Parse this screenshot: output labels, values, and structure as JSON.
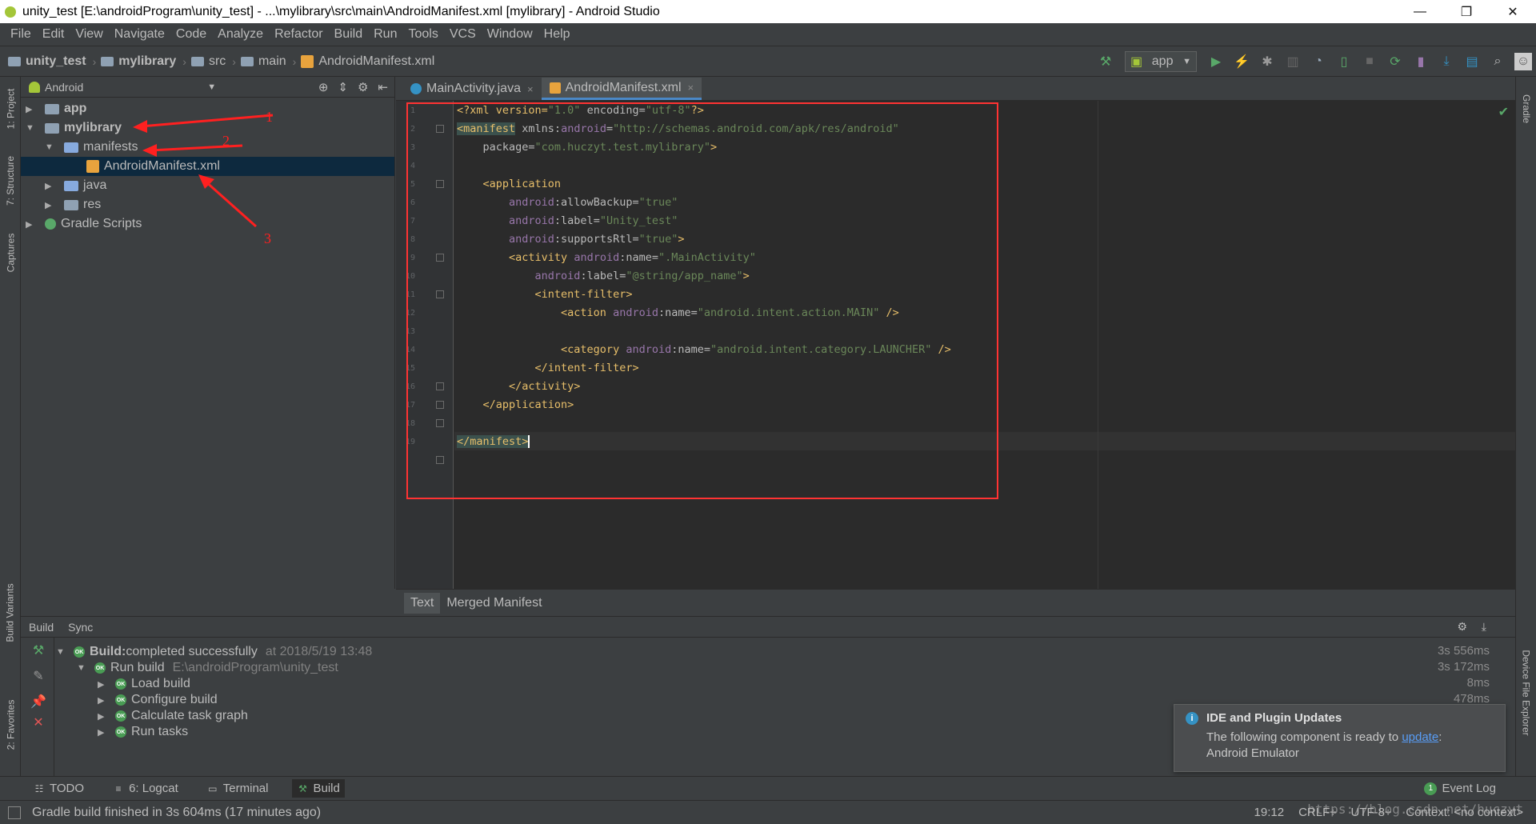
{
  "window": {
    "title": "unity_test [E:\\androidProgram\\unity_test] - ...\\mylibrary\\src\\main\\AndroidManifest.xml [mylibrary] - Android Studio",
    "minimize": "—",
    "restore": "❐",
    "close": "✕"
  },
  "menu": [
    "File",
    "Edit",
    "View",
    "Navigate",
    "Code",
    "Analyze",
    "Refactor",
    "Build",
    "Run",
    "Tools",
    "VCS",
    "Window",
    "Help"
  ],
  "breadcrumb": [
    "unity_test",
    "mylibrary",
    "src",
    "main",
    "AndroidManifest.xml"
  ],
  "run_config": "app",
  "left_tools": [
    "1: Project",
    "7: Structure",
    "Captures",
    "Build Variants",
    "2: Favorites"
  ],
  "right_tools": [
    "Gradle",
    "Device File Explorer"
  ],
  "project": {
    "view": "Android",
    "tree": [
      "app",
      "mylibrary",
      "manifests",
      "AndroidManifest.xml",
      "java",
      "res",
      "Gradle Scripts"
    ]
  },
  "annotations": [
    "1",
    "2",
    "3"
  ],
  "editor": {
    "tabs": [
      "MainActivity.java",
      "AndroidManifest.xml"
    ],
    "line_numbers": [
      "1",
      "2",
      "3",
      "4",
      "5",
      "6",
      "7",
      "8",
      "9",
      "10",
      "11",
      "12",
      "13",
      "14",
      "15",
      "16",
      "17",
      "18",
      "19"
    ],
    "code": {
      "l1a": "<?xml version=",
      "l1b": "\"1.0\"",
      "l1c": " encoding=",
      "l1d": "\"utf-8\"",
      "l1e": "?>",
      "l2a": "<manifest",
      "l2b": " xmlns:",
      "l2c": "android",
      "l2d": "=",
      "l2e": "\"http://schemas.android.com/apk/res/android\"",
      "l3a": "    package=",
      "l3b": "\"com.huczyt.test.mylibrary\"",
      "l3c": ">",
      "l5": "    <application",
      "l6a": "        android",
      "l6b": ":allowBackup=",
      "l6c": "\"true\"",
      "l7a": "        android",
      "l7b": ":label=",
      "l7c": "\"Unity_test\"",
      "l8a": "        android",
      "l8b": ":supportsRtl=",
      "l8c": "\"true\"",
      "l8d": ">",
      "l9a": "        <activity ",
      "l9b": "android",
      "l9c": ":name=",
      "l9d": "\".MainActivity\"",
      "l10a": "            android",
      "l10b": ":label=",
      "l10c": "\"@string/app_name\"",
      "l10d": ">",
      "l11": "            <intent-filter>",
      "l12a": "                <action ",
      "l12b": "android",
      "l12c": ":name=",
      "l12d": "\"android.intent.action.MAIN\"",
      "l12e": " />",
      "l14a": "                <category ",
      "l14b": "android",
      "l14c": ":name=",
      "l14d": "\"android.intent.category.LAUNCHER\"",
      "l14e": " />",
      "l15": "            </intent-filter>",
      "l16": "        </activity>",
      "l17": "    </application>",
      "l19": "</manifest>"
    },
    "bottom_tabs": [
      "Text",
      "Merged Manifest"
    ]
  },
  "build": {
    "header_tabs": [
      "Build",
      "Sync"
    ],
    "rows": [
      {
        "label": "Build:",
        "rest": " completed successfully",
        "detail": "at 2018/5/19 13:48",
        "time": "3s 556ms"
      },
      {
        "label": "Run build",
        "detail": "E:\\androidProgram\\unity_test",
        "time": "3s 172ms"
      },
      {
        "label": "Load build",
        "time": "8ms"
      },
      {
        "label": "Configure build",
        "time": "478ms"
      },
      {
        "label": "Calculate task graph",
        "time": ""
      },
      {
        "label": "Run tasks",
        "time": ""
      }
    ]
  },
  "notification": {
    "title": "IDE and Plugin Updates",
    "text": "The following component is ready to ",
    "link": "update",
    "after": ":",
    "line2": "Android Emulator"
  },
  "toolwindows": [
    "TODO",
    "6: Logcat",
    "Terminal",
    "Build"
  ],
  "event_log": "Event Log",
  "event_log_count": "1",
  "status": {
    "message": "Gradle build finished in 3s 604ms (17 minutes ago)",
    "position": "19:12",
    "line_sep": "CRLF÷",
    "encoding": "UTF-8÷",
    "context": "Context: <no context>"
  },
  "watermark": "https://blog.csdn.net/huczyt"
}
